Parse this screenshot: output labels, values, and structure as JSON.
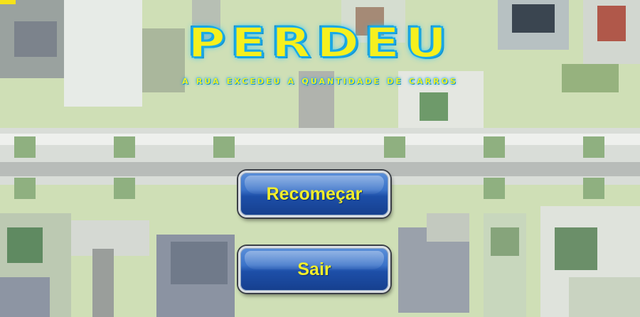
{
  "game_over": {
    "title": "PERDEU",
    "subtitle": "a rua excedeu a quantidade de carros"
  },
  "buttons": {
    "restart_label": "Recomeçar",
    "exit_label": "Sair"
  },
  "colors": {
    "title_fill": "#f6f01e",
    "title_glow": "#1aa9e6",
    "button_blue": "#1d4fa8",
    "button_text": "#f2ee2a",
    "background_grass": "#cfe0b8"
  }
}
